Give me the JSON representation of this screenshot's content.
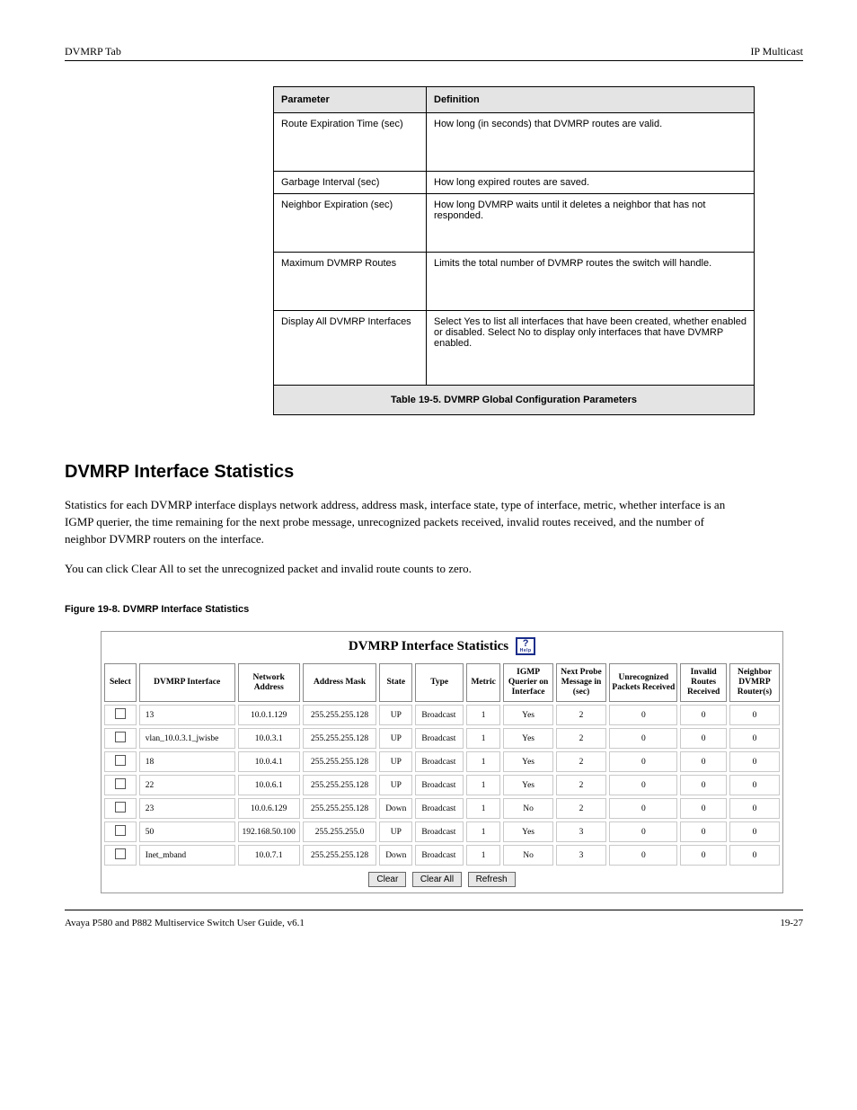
{
  "header": {
    "left": "DVMRP Tab",
    "right": "IP Multicast"
  },
  "footer": {
    "left": "Avaya P580 and P882 Multiservice Switch User Guide, v6.1",
    "right": "19-27"
  },
  "param_table": {
    "headers": [
      "Parameter",
      "Definition"
    ],
    "rows": [
      {
        "p": "Route Expiration Time (sec)",
        "d": "How long (in seconds) that DVMRP routes are valid.",
        "cls": "tall"
      },
      {
        "p": "Garbage Interval (sec)",
        "d": "How long expired routes are saved.",
        "cls": ""
      },
      {
        "p": "Neighbor Expiration (sec)",
        "d": "How long DVMRP waits until it deletes a neighbor that has not responded.",
        "cls": "tall"
      },
      {
        "p": "Maximum DVMRP Routes",
        "d": "Limits the total number of DVMRP routes the switch will handle.",
        "cls": "tall"
      },
      {
        "p": "Display All DVMRP Interfaces",
        "d": "Select Yes to list all interfaces that have been created, whether enabled or disabled. Select No to display only interfaces that have DVMRP enabled.",
        "cls": "taller"
      }
    ],
    "caption": "Table 19-5. DVMRP Global Configuration Parameters"
  },
  "section": {
    "title": "DVMRP Interface Statistics",
    "p1": "Statistics for each DVMRP interface displays network address, address mask, interface state, type of interface, metric, whether interface is an IGMP querier, the time remaining for the next probe message, unrecognized packets received, invalid routes received, and the number of neighbor DVMRP routers on the interface.",
    "p2": "You can click Clear All to set the unrecognized packet and invalid route counts to zero.",
    "fig_caption": "Figure 19-8. DVMRP Interface Statistics"
  },
  "shot": {
    "title": "DVMRP Interface Statistics",
    "headers": [
      "Select",
      "DVMRP Interface",
      "Network Address",
      "Address Mask",
      "State",
      "Type",
      "Metric",
      "IGMP Querier on Interface",
      "Next Probe Message in (sec)",
      "Unrecognized Packets Received",
      "Invalid Routes Received",
      "Neighbor DVMRP Router(s)"
    ],
    "rows": [
      {
        "iface": "13",
        "addr": "10.0.1.129",
        "mask": "255.255.255.128",
        "state": "UP",
        "type": "Broadcast",
        "metric": "1",
        "igmp": "Yes",
        "probe": "2",
        "unrec": "0",
        "inval": "0",
        "nbr": "0"
      },
      {
        "iface": "vlan_10.0.3.1_jwisbe",
        "addr": "10.0.3.1",
        "mask": "255.255.255.128",
        "state": "UP",
        "type": "Broadcast",
        "metric": "1",
        "igmp": "Yes",
        "probe": "2",
        "unrec": "0",
        "inval": "0",
        "nbr": "0"
      },
      {
        "iface": "18",
        "addr": "10.0.4.1",
        "mask": "255.255.255.128",
        "state": "UP",
        "type": "Broadcast",
        "metric": "1",
        "igmp": "Yes",
        "probe": "2",
        "unrec": "0",
        "inval": "0",
        "nbr": "0"
      },
      {
        "iface": "22",
        "addr": "10.0.6.1",
        "mask": "255.255.255.128",
        "state": "UP",
        "type": "Broadcast",
        "metric": "1",
        "igmp": "Yes",
        "probe": "2",
        "unrec": "0",
        "inval": "0",
        "nbr": "0"
      },
      {
        "iface": "23",
        "addr": "10.0.6.129",
        "mask": "255.255.255.128",
        "state": "Down",
        "type": "Broadcast",
        "metric": "1",
        "igmp": "No",
        "probe": "2",
        "unrec": "0",
        "inval": "0",
        "nbr": "0"
      },
      {
        "iface": "50",
        "addr": "192.168.50.100",
        "mask": "255.255.255.0",
        "state": "UP",
        "type": "Broadcast",
        "metric": "1",
        "igmp": "Yes",
        "probe": "3",
        "unrec": "0",
        "inval": "0",
        "nbr": "0"
      },
      {
        "iface": "Inet_mband",
        "addr": "10.0.7.1",
        "mask": "255.255.255.128",
        "state": "Down",
        "type": "Broadcast",
        "metric": "1",
        "igmp": "No",
        "probe": "3",
        "unrec": "0",
        "inval": "0",
        "nbr": "0"
      }
    ],
    "buttons": {
      "clear": "Clear",
      "clear_all": "Clear All",
      "refresh": "Refresh"
    }
  }
}
